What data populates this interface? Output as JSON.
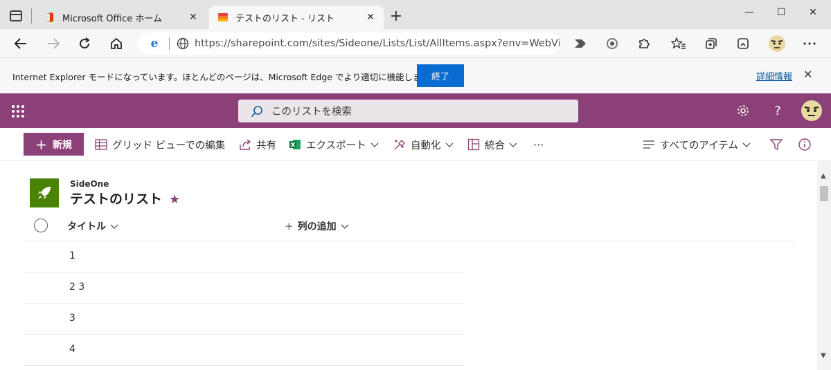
{
  "browser": {
    "tabs": [
      {
        "title": "Microsoft Office ホーム",
        "close": "✕"
      },
      {
        "title": "テストのリスト - リスト",
        "close": "✕"
      }
    ],
    "new_tab": "+",
    "window": {
      "minimize": "—",
      "maximize": "☐",
      "close": "✕"
    },
    "address": {
      "url": "https://sharepoint.com/sites/Sideone/Lists/List/AllItems.aspx?env=WebVie..."
    },
    "ie_banner": {
      "message": "Internet Explorer モードになっています。ほとんどのページは、Microsoft Edge でより適切に機能します。",
      "end_button": "終了",
      "more_info": "詳細情報",
      "close": "✕"
    }
  },
  "suite": {
    "search_placeholder": "このリストを検索",
    "settings_icon": "gear-icon",
    "help": "?"
  },
  "commands": {
    "new": "新規",
    "grid_edit": "グリッド ビューでの編集",
    "share": "共有",
    "export": "エクスポート",
    "automate": "自動化",
    "integrate": "統合",
    "more": "···",
    "view": "すべてのアイテム"
  },
  "site": {
    "name": "SideOne",
    "list_title": "テストのリスト"
  },
  "list": {
    "columns": {
      "title": "タイトル",
      "add_column": "列の追加"
    },
    "rows": [
      {
        "title": "1"
      },
      {
        "title": "2 3"
      },
      {
        "title": "3"
      },
      {
        "title": "4"
      }
    ]
  },
  "colors": {
    "suite_bar": "#8b4178",
    "accent_button": "#0a6bd1",
    "site_logo": "#498205"
  }
}
